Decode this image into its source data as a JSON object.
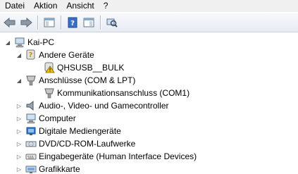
{
  "menu": {
    "items": [
      {
        "label": "Datei"
      },
      {
        "label": "Aktion"
      },
      {
        "label": "Ansicht"
      },
      {
        "label": "?"
      }
    ]
  },
  "toolbar": {
    "buttons": [
      "back-arrow-icon",
      "forward-arrow-icon",
      "show-hide-tree-icon",
      "help-icon",
      "properties-icon",
      "scan-hardware-icon"
    ]
  },
  "tree": {
    "root": {
      "label": "Kai-PC",
      "expanded": true,
      "icon": "computer-icon"
    },
    "nodes": [
      {
        "label": "Andere Geräte",
        "expanded": true,
        "icon": "unknown-device-icon"
      },
      {
        "label": "QHSUSB__BULK",
        "icon": "warning-device-icon"
      },
      {
        "label": "Anschlüsse (COM & LPT)",
        "expanded": true,
        "icon": "port-icon"
      },
      {
        "label": "Kommunikationsanschluss (COM1)",
        "icon": "port-icon"
      },
      {
        "label": "Audio-, Video- und Gamecontroller",
        "expanded": false,
        "icon": "speaker-icon"
      },
      {
        "label": "Computer",
        "expanded": false,
        "icon": "computer-icon"
      },
      {
        "label": "Digitale Mediengeräte",
        "expanded": false,
        "icon": "media-device-icon"
      },
      {
        "label": "DVD/CD-ROM-Laufwerke",
        "expanded": false,
        "icon": "dvd-drive-icon"
      },
      {
        "label": "Eingabegeräte (Human Interface Devices)",
        "expanded": false,
        "icon": "input-device-icon"
      },
      {
        "label": "Grafikkarte",
        "expanded": false,
        "icon": "display-adapter-icon"
      }
    ]
  },
  "colors": {
    "warning": "#f5c400",
    "accent": "#2f7bd0"
  }
}
